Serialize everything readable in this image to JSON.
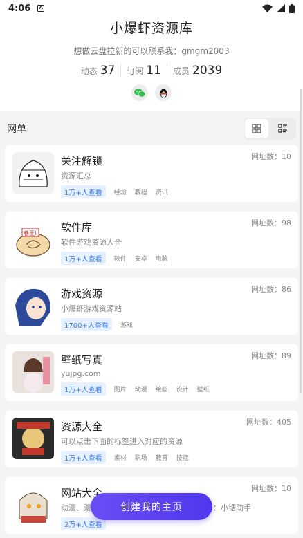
{
  "statusbar": {
    "time": "4:06",
    "a_glyph": "A"
  },
  "profile": {
    "title": "小爆虾资源库",
    "subtitle": "想做云盘拉新的可以联系我：gmgm2003",
    "stats": [
      {
        "label": "动态",
        "value": "37"
      },
      {
        "label": "订阅",
        "value": "11"
      },
      {
        "label": "成员",
        "value": "2039"
      }
    ]
  },
  "section": {
    "label": "网单"
  },
  "cards": [
    {
      "name": "关注解锁",
      "desc": "资源汇总",
      "views": "1万+人查看",
      "tags": [
        "经验",
        "教程",
        "资讯"
      ],
      "count": "网址数：10",
      "thumb_color": "#f2f2f2"
    },
    {
      "name": "软件库",
      "desc": "软件游戏资源大全",
      "views": "1万+人查看",
      "tags": [
        "软件",
        "安卓",
        "电脑"
      ],
      "count": "网址数：98",
      "thumb_color": "#f7e6c8"
    },
    {
      "name": "游戏资源",
      "desc": "小爆虾游戏资源站",
      "views": "1700+人查看",
      "tags": [
        "游戏"
      ],
      "count": "网址数：86",
      "thumb_color": "#2d4a9a"
    },
    {
      "name": "壁纸写真",
      "desc": "yujpg.com",
      "views": "1万+人查看",
      "tags": [
        "图片",
        "动漫",
        "绘画",
        "设计",
        "壁纸"
      ],
      "count": "网址数：89",
      "thumb_color": "#e9e2dc"
    },
    {
      "name": "资源大全",
      "desc": "可以点击下面的标签进入对应的资源",
      "views": "1万+人查看",
      "tags": [
        "素材",
        "职场",
        "教育",
        "技能"
      ],
      "count": "网址数：405",
      "thumb_color": "#2b2b2b"
    },
    {
      "name": "网站大全",
      "desc": "动漫、漫画、小说、壁纸等各种网站，公众号：小锶助手",
      "views": "2万+人查看",
      "tags": [],
      "count": "网址数：10",
      "thumb_color": "#eadfce"
    }
  ],
  "fab": {
    "label": "创建我的主页"
  },
  "colors": {
    "accent": "#5b42f1",
    "tag_blue": "#3a7be8"
  }
}
